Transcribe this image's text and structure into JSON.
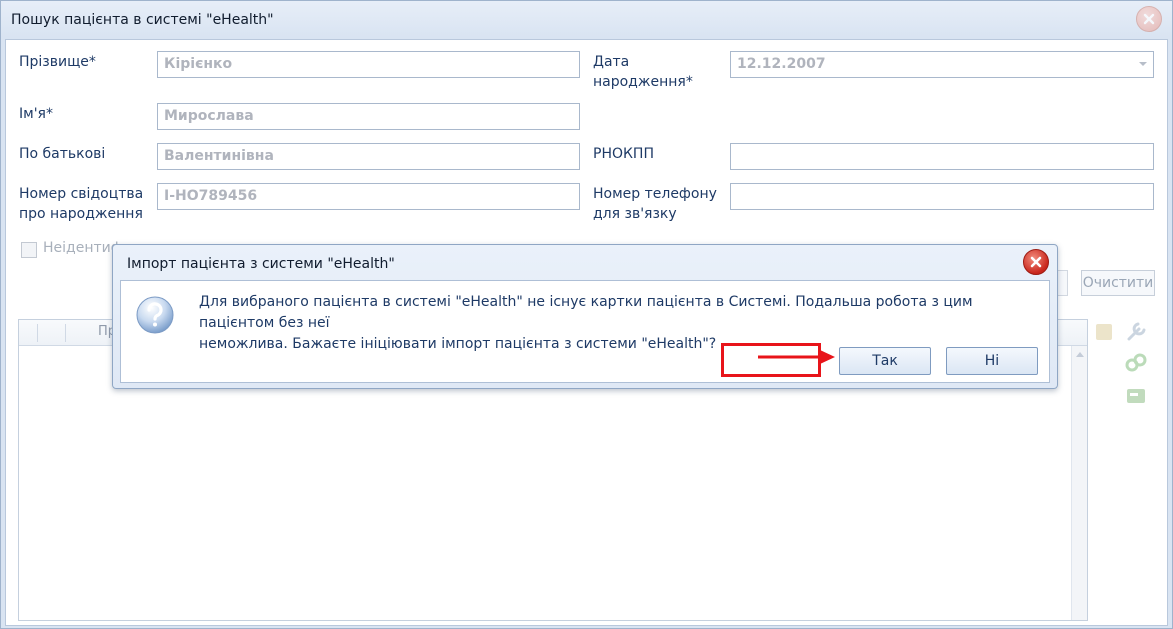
{
  "window": {
    "title": "Пошук пацієнта в системі \"eHealth\""
  },
  "form": {
    "surname_label": "Прізвище*",
    "surname_value": "Кірієнко",
    "name_label": "Ім'я*",
    "name_value": "Мирослава",
    "patronymic_label": "По батькові",
    "patronymic_value": "Валентинівна",
    "birth_cert_label_line1": "Номер свідоцтва",
    "birth_cert_label_line2": "про народження",
    "birth_cert_value": "І-НО789456",
    "birthdate_label_line1": "Дата",
    "birthdate_label_line2": "народження*",
    "birthdate_value": "12.12.2007",
    "rnokpp_label": "РНОКПП",
    "rnokpp_value": "",
    "phone_label_line1": "Номер телефону",
    "phone_label_line2": "для зв'язку",
    "phone_value": "",
    "unidentified_label": "Неідентиф"
  },
  "toolbar": {
    "clear_label": "Очистити"
  },
  "grid": {
    "first_column_label": "Пр"
  },
  "dialog": {
    "title": "Імпорт пацієнта з системи \"eHealth\"",
    "message_line1": "Для вибраного пацієнта в системі \"eHealth\" не існує картки пацієнта в Системі. Подальша робота з цим пацієнтом без неї",
    "message_line2": "неможлива. Бажаєте ініціювати імпорт пацієнта з системи \"eHealth\"?",
    "yes_label": "Так",
    "no_label": "Ні"
  },
  "icons": [
    "close-icon",
    "question-icon",
    "wrench-icon",
    "link-icon",
    "card-icon"
  ],
  "colors": {
    "highlight": "#e8141a",
    "accent": "#1e3a66"
  }
}
